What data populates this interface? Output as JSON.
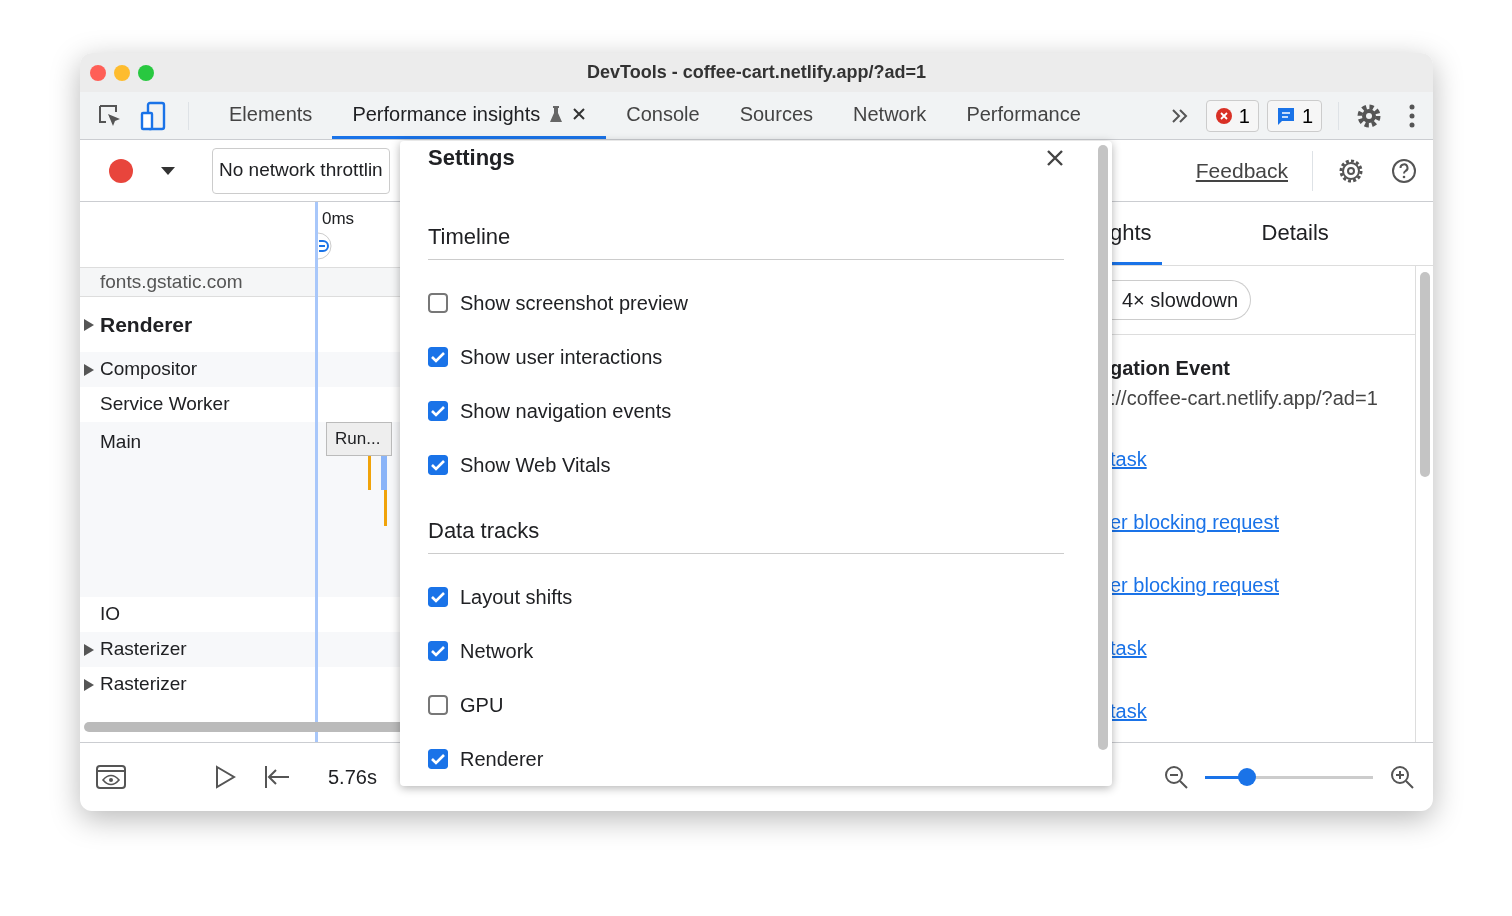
{
  "window": {
    "title": "DevTools - coffee-cart.netlify.app/?ad=1"
  },
  "tabs": [
    {
      "label": "Elements",
      "selected": false,
      "closable": false
    },
    {
      "label": "Performance insights",
      "selected": true,
      "closable": true
    },
    {
      "label": "Console",
      "selected": false,
      "closable": false
    },
    {
      "label": "Sources",
      "selected": false,
      "closable": false
    },
    {
      "label": "Network",
      "selected": false,
      "closable": false
    },
    {
      "label": "Performance",
      "selected": false,
      "closable": false
    }
  ],
  "counters": [
    {
      "kind": "error",
      "count": "1"
    },
    {
      "kind": "message",
      "count": "1"
    }
  ],
  "toolbar": {
    "throttling": "No network throttlin",
    "feedback": "Feedback"
  },
  "timeline": {
    "tick": "0ms",
    "event": "Run..."
  },
  "tracks": [
    {
      "label": "fonts.gstatic.com",
      "kind": "network"
    },
    {
      "label": "Renderer",
      "kind": "group",
      "expanded": false
    },
    {
      "label": "Compositor",
      "kind": "thread",
      "expanded": false
    },
    {
      "label": "Service Worker",
      "kind": "thread"
    },
    {
      "label": "Main",
      "kind": "main"
    },
    {
      "label": "IO",
      "kind": "thread"
    },
    {
      "label": "Rasterizer",
      "kind": "thread",
      "expanded": false
    },
    {
      "label": "Rasterizer",
      "kind": "thread",
      "expanded": false
    }
  ],
  "side_tabs": [
    {
      "label": "ghts",
      "selected": true
    },
    {
      "label": "Details",
      "selected": false
    }
  ],
  "side": {
    "chip": "4× slowdown",
    "event_title": "gation Event",
    "event_url": "://coffee-cart.netlify.app/?ad=1",
    "links": [
      "task",
      "er blocking request",
      "er blocking request",
      "task",
      "task"
    ]
  },
  "bottom": {
    "time": "5.76s",
    "zoom": {
      "level": 0.25
    }
  },
  "settings": {
    "title": "Settings",
    "sections": [
      {
        "heading": "Timeline",
        "options": [
          {
            "label": "Show screenshot preview",
            "checked": false
          },
          {
            "label": "Show user interactions",
            "checked": true
          },
          {
            "label": "Show navigation events",
            "checked": true
          },
          {
            "label": "Show Web Vitals",
            "checked": true
          }
        ]
      },
      {
        "heading": "Data tracks",
        "options": [
          {
            "label": "Layout shifts",
            "checked": true
          },
          {
            "label": "Network",
            "checked": true
          },
          {
            "label": "GPU",
            "checked": false
          },
          {
            "label": "Renderer",
            "checked": true
          }
        ]
      }
    ]
  }
}
